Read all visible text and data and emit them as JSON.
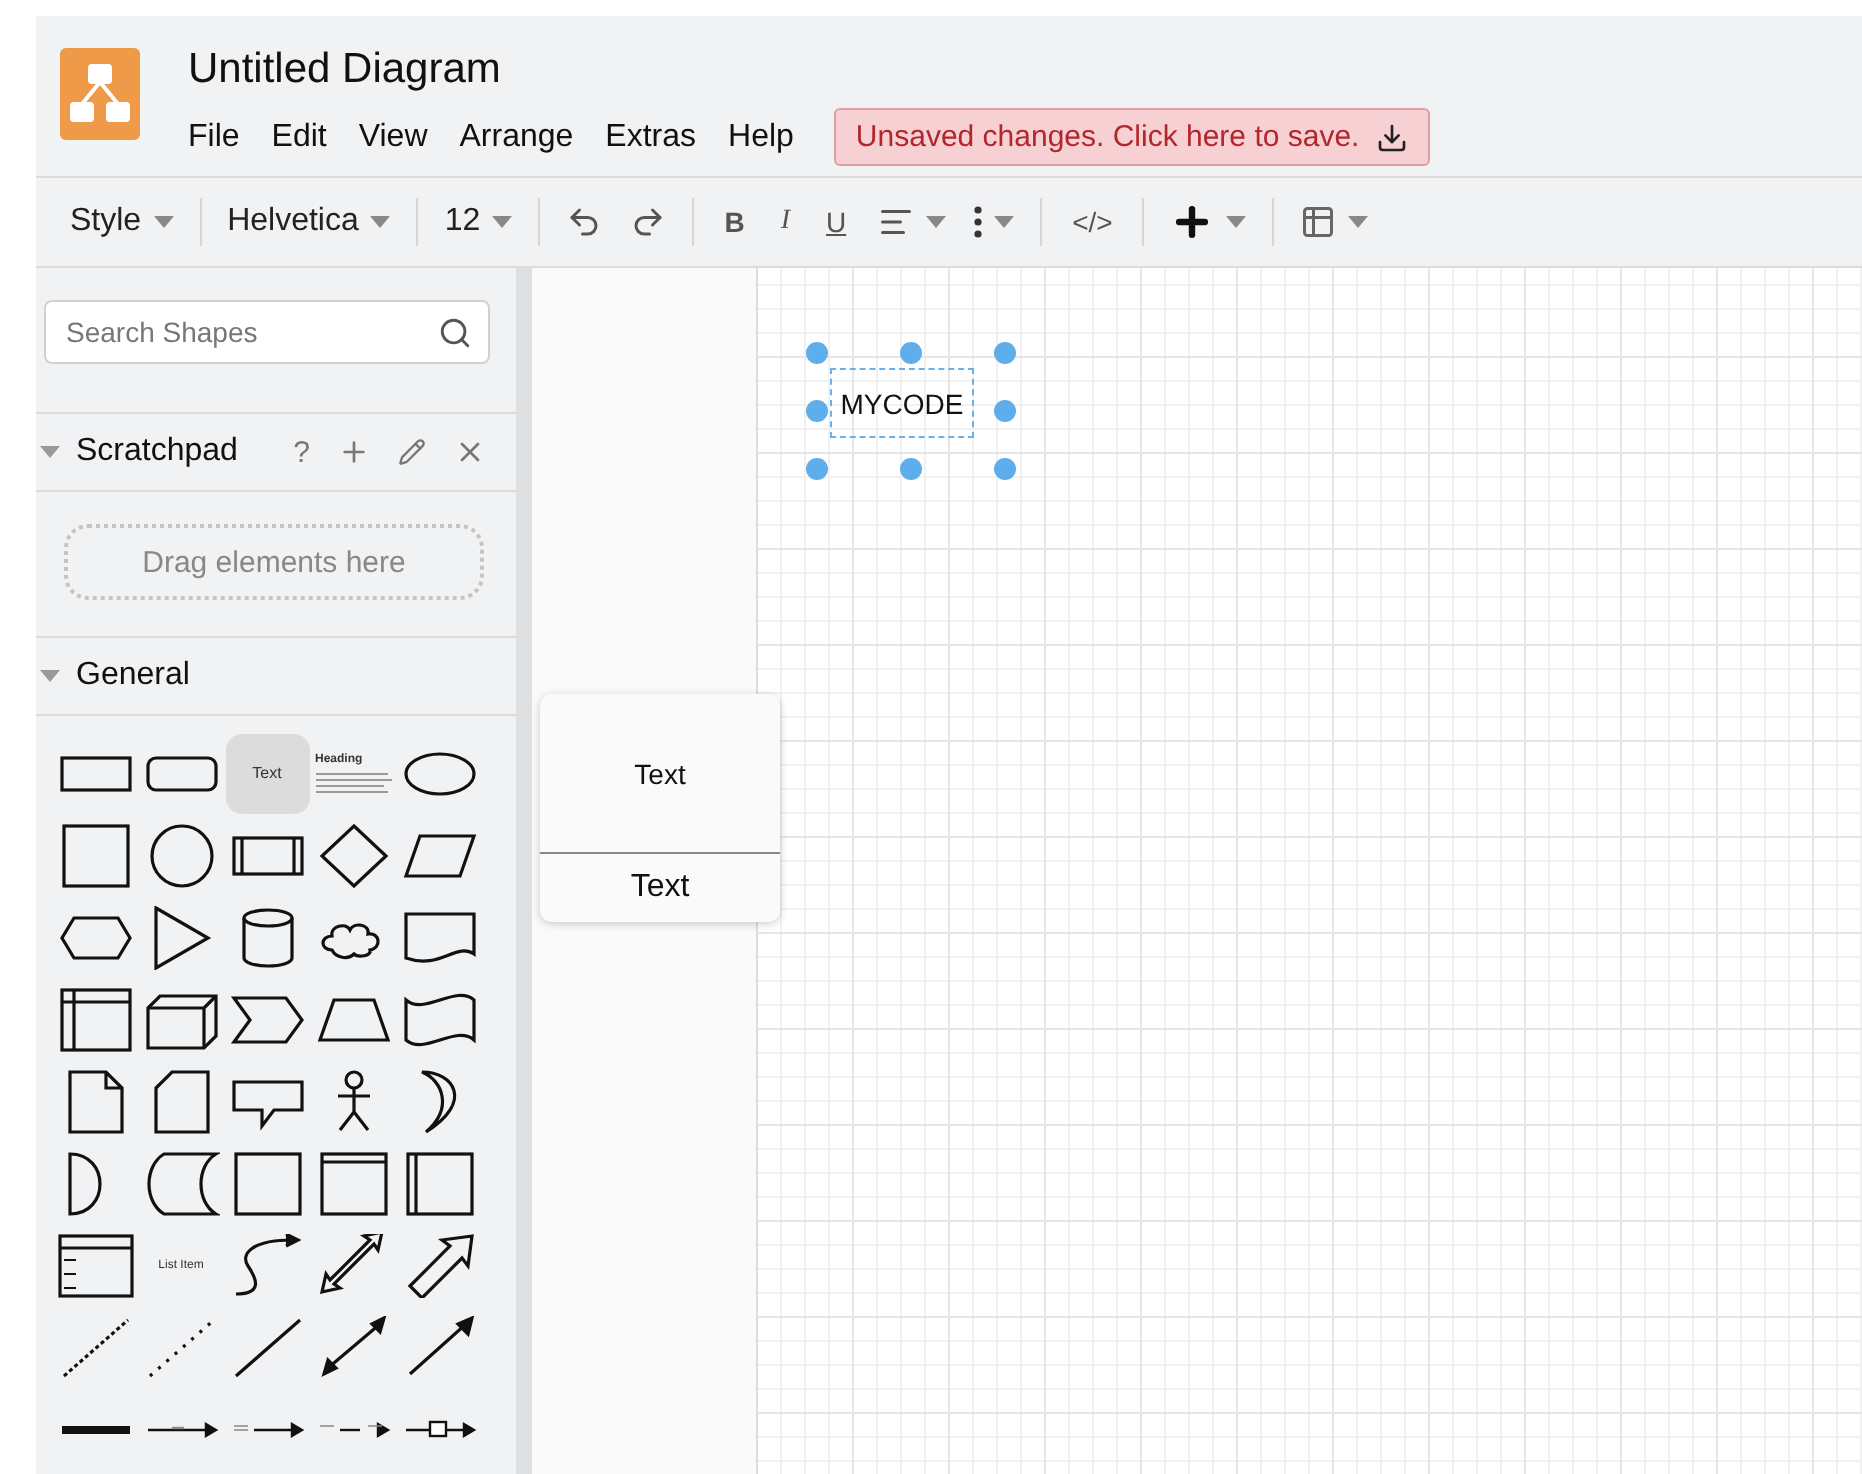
{
  "window": {
    "title": "Untitled Diagram"
  },
  "menu": [
    "File",
    "Edit",
    "View",
    "Arrange",
    "Extras",
    "Help"
  ],
  "save_notice": "Unsaved changes. Click here to save.",
  "toolbar": [
    {
      "kind": "dropdown",
      "label": "Style"
    },
    {
      "kind": "separator"
    },
    {
      "kind": "dropdown",
      "label": "Helvetica"
    },
    {
      "kind": "separator"
    },
    {
      "kind": "dropdown",
      "label": "12"
    },
    {
      "kind": "separator"
    },
    {
      "kind": "undo"
    },
    {
      "kind": "redo"
    },
    {
      "kind": "separator"
    },
    {
      "kind": "bold",
      "label": "B"
    },
    {
      "kind": "italic",
      "label": "I"
    },
    {
      "kind": "underline",
      "label": "U"
    },
    {
      "kind": "align"
    },
    {
      "kind": "more"
    },
    {
      "kind": "separator"
    },
    {
      "kind": "code",
      "label": "</>"
    },
    {
      "kind": "separator"
    },
    {
      "kind": "insert"
    },
    {
      "kind": "separator"
    },
    {
      "kind": "table"
    }
  ],
  "sidebar": {
    "search": {
      "placeholder": "Search Shapes"
    },
    "scratchpad": {
      "title": "Scratchpad",
      "help": "?",
      "expanded": true,
      "hint": "Drag elements here"
    },
    "general": {
      "title": "General",
      "expanded": true,
      "shapes": [
        {
          "kind": "rect"
        },
        {
          "kind": "rounded"
        },
        {
          "kind": "text",
          "label": "Text",
          "selected": true
        },
        {
          "kind": "heading",
          "label": "Heading"
        },
        {
          "kind": "ellipse"
        },
        {
          "kind": "square"
        },
        {
          "kind": "circle"
        },
        {
          "kind": "process"
        },
        {
          "kind": "diamond"
        },
        {
          "kind": "parallelogram"
        },
        {
          "kind": "hexagon"
        },
        {
          "kind": "triangle"
        },
        {
          "kind": "cylinder"
        },
        {
          "kind": "cloud"
        },
        {
          "kind": "document"
        },
        {
          "kind": "internal"
        },
        {
          "kind": "cube"
        },
        {
          "kind": "step"
        },
        {
          "kind": "trapezoid"
        },
        {
          "kind": "tape"
        },
        {
          "kind": "note"
        },
        {
          "kind": "card"
        },
        {
          "kind": "callout"
        },
        {
          "kind": "actor"
        },
        {
          "kind": "crescent"
        },
        {
          "kind": "and"
        },
        {
          "kind": "storage"
        },
        {
          "kind": "square"
        },
        {
          "kind": "container"
        },
        {
          "kind": "vcontainer"
        },
        {
          "kind": "list"
        },
        {
          "kind": "listitem",
          "label": "List Item"
        },
        {
          "kind": "curve"
        },
        {
          "kind": "bidirarrow"
        },
        {
          "kind": "bigarrow"
        },
        {
          "kind": "dashed"
        },
        {
          "kind": "dotted"
        },
        {
          "kind": "line"
        },
        {
          "kind": "biconnector"
        },
        {
          "kind": "connector"
        },
        {
          "kind": "thick"
        },
        {
          "kind": "edgelabel"
        },
        {
          "kind": "edgelabel2"
        },
        {
          "kind": "edgelabel3"
        },
        {
          "kind": "edgeicon"
        }
      ]
    }
  },
  "preview": {
    "top": "Text",
    "bottom": "Text"
  },
  "canvas": {
    "nodes": [
      {
        "label": "MYCODE",
        "selected": true
      }
    ]
  }
}
